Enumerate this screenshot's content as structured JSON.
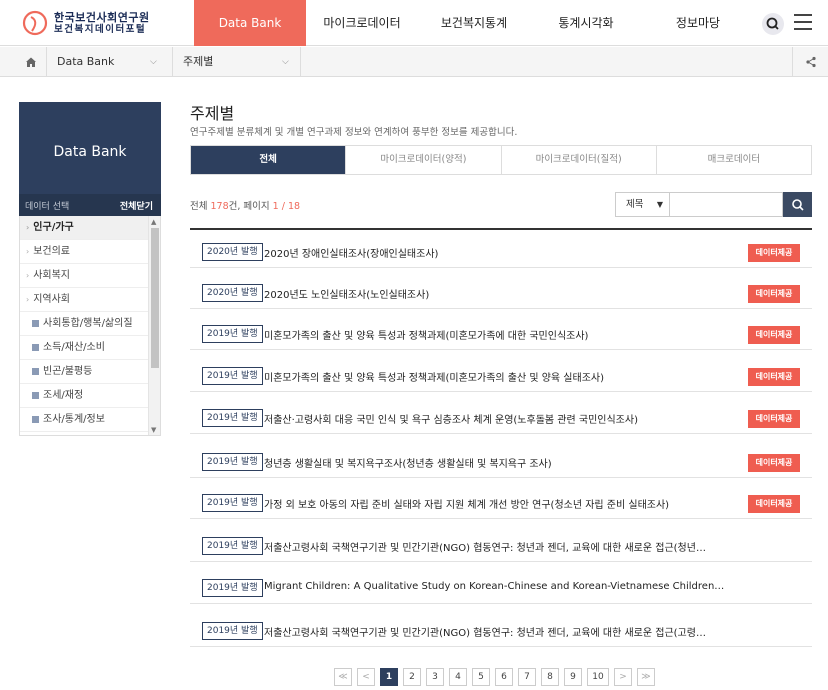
{
  "brand": {
    "name_line1": "한국보건사회연구원",
    "name_line2": "보건복지데이터포털",
    "accent_color": "#ef6a5b",
    "navy_color": "#2d3f5e"
  },
  "gnb": {
    "items": [
      "Data Bank",
      "마이크로데이터",
      "보건복지통계",
      "통계시각화",
      "정보마당"
    ],
    "active_index": 0,
    "search_icon": "search-icon",
    "menu_icon": "hamburger-menu-icon"
  },
  "breadcrumb": {
    "home_icon": "home-icon",
    "level1": "Data Bank",
    "level2": "주제별",
    "share_icon": "share-icon"
  },
  "sidebar": {
    "title": "Data Bank",
    "select_label": "데이터 선택",
    "close_all": "전체닫기",
    "items": [
      {
        "label": "인구/가구",
        "type": "category",
        "active": true
      },
      {
        "label": "보건의료",
        "type": "category"
      },
      {
        "label": "사회복지",
        "type": "category"
      },
      {
        "label": "지역사회",
        "type": "category"
      },
      {
        "label": "사회통합/행복/삶의질",
        "type": "sub"
      },
      {
        "label": "소득/재산/소비",
        "type": "sub"
      },
      {
        "label": "빈곤/불평등",
        "type": "sub"
      },
      {
        "label": "조세/재정",
        "type": "sub"
      },
      {
        "label": "조사/통계/정보",
        "type": "sub"
      }
    ]
  },
  "main": {
    "title": "주제별",
    "description": "연구주제별 분류체계 및 개별 연구과제 정보와 연계하여 풍부한 정보를 제공합니다.",
    "tabs": [
      "전체",
      "마이크로데이터(양적)",
      "마이크로데이터(질적)",
      "매크로데이터"
    ],
    "active_tab": 0,
    "count_prefix": "전체 ",
    "count_total": "178",
    "count_mid": "건, 페이지 ",
    "page_current": "1",
    "page_sep": " / ",
    "page_total": "18",
    "search_select": "제목",
    "search_placeholder": ""
  },
  "list": [
    {
      "badge": "2020년 발행",
      "title": "2020년 장애인실태조사(장애인실태조사)",
      "button": "데이터제공"
    },
    {
      "badge": "2020년 발행",
      "title": "2020년도 노인실태조사(노인실태조사)",
      "button": "데이터제공"
    },
    {
      "badge": "2019년 발행",
      "title": "미혼모가족의 출산 및 양육 특성과 정책과제(미혼모가족에 대한 국민인식조사)",
      "button": "데이터제공"
    },
    {
      "badge": "2019년 발행",
      "title": "미혼모가족의 출산 및 양육 특성과 정책과제(미혼모가족의 출산 및 양육 실태조사)",
      "button": "데이터제공"
    },
    {
      "badge": "2019년 발행",
      "title": "저출산·고령사회 대응 국민 인식 및 욕구 심층조사 체계 운영(노후돌봄 관련 국민인식조사)",
      "button": "데이터제공"
    },
    {
      "badge": "2019년 발행",
      "title": "청년층 생활실태 및 복지욕구조사(청년층 생활실태 및 복지욕구 조사)",
      "button": "데이터제공"
    },
    {
      "badge": "2019년 발행",
      "title": "가정 외 보호 아동의 자립 준비 실태와 자립 지원 체계 개선 방안 연구(청소년 자립 준비 실태조사)",
      "button": "데이터제공"
    },
    {
      "badge": "2019년 발행",
      "title": "저출산고령사회 국책연구기관 및 민간기관(NGO) 협동연구: 청년과 젠더, 교육에 대한 새로운 접근(청년…",
      "button": ""
    },
    {
      "badge": "2019년 발행",
      "title": "Migrant Children: A Qualitative Study on Korean-Chinese and Korean-Vietnamese Children…",
      "button": ""
    },
    {
      "badge": "2019년 발행",
      "title": "저출산고령사회 국책연구기관 및 민간기관(NGO) 협동연구: 청년과 젠더, 교육에 대한 새로운 접근(고령…",
      "button": ""
    }
  ],
  "pagination": {
    "first": "≪",
    "prev": "<",
    "pages": [
      "1",
      "2",
      "3",
      "4",
      "5",
      "6",
      "7",
      "8",
      "9",
      "10"
    ],
    "current": "1",
    "next": ">",
    "last": "≫"
  }
}
